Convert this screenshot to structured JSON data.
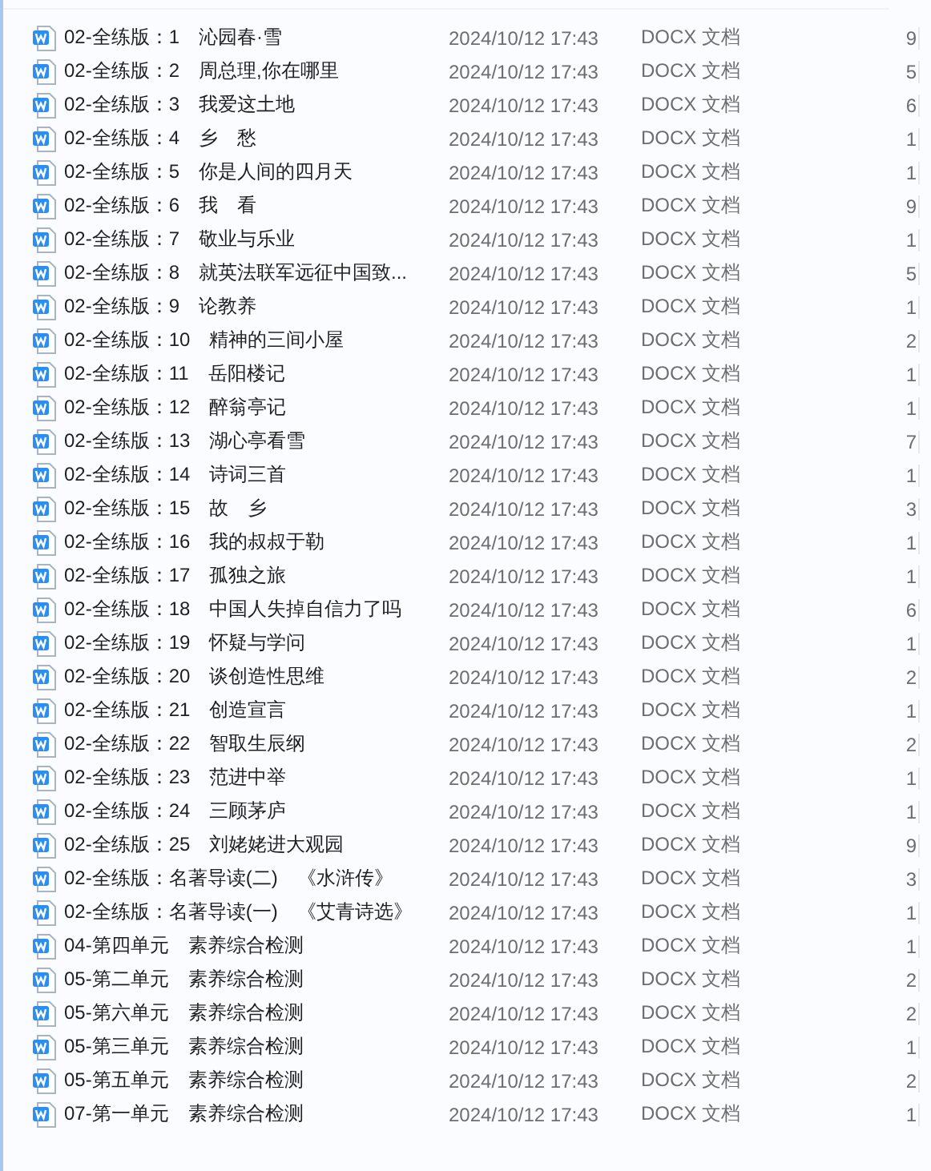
{
  "files": [
    {
      "name": "02-全练版：1　沁园春·雪",
      "modified": "2024/10/12 17:43",
      "type": "DOCX 文档",
      "size": "9"
    },
    {
      "name": "02-全练版：2　周总理,你在哪里",
      "modified": "2024/10/12 17:43",
      "type": "DOCX 文档",
      "size": "5"
    },
    {
      "name": "02-全练版：3　我爱这土地",
      "modified": "2024/10/12 17:43",
      "type": "DOCX 文档",
      "size": "6"
    },
    {
      "name": "02-全练版：4　乡　愁",
      "modified": "2024/10/12 17:43",
      "type": "DOCX 文档",
      "size": "1"
    },
    {
      "name": "02-全练版：5　你是人间的四月天",
      "modified": "2024/10/12 17:43",
      "type": "DOCX 文档",
      "size": "1"
    },
    {
      "name": "02-全练版：6　我　看",
      "modified": "2024/10/12 17:43",
      "type": "DOCX 文档",
      "size": "9"
    },
    {
      "name": "02-全练版：7　敬业与乐业",
      "modified": "2024/10/12 17:43",
      "type": "DOCX 文档",
      "size": "1"
    },
    {
      "name": "02-全练版：8　就英法联军远征中国致...",
      "modified": "2024/10/12 17:43",
      "type": "DOCX 文档",
      "size": "5"
    },
    {
      "name": "02-全练版：9　论教养",
      "modified": "2024/10/12 17:43",
      "type": "DOCX 文档",
      "size": "1"
    },
    {
      "name": "02-全练版：10　精神的三间小屋",
      "modified": "2024/10/12 17:43",
      "type": "DOCX 文档",
      "size": "2"
    },
    {
      "name": "02-全练版：11　岳阳楼记",
      "modified": "2024/10/12 17:43",
      "type": "DOCX 文档",
      "size": "1"
    },
    {
      "name": "02-全练版：12　醉翁亭记",
      "modified": "2024/10/12 17:43",
      "type": "DOCX 文档",
      "size": "1"
    },
    {
      "name": "02-全练版：13　湖心亭看雪",
      "modified": "2024/10/12 17:43",
      "type": "DOCX 文档",
      "size": "7"
    },
    {
      "name": "02-全练版：14　诗词三首",
      "modified": "2024/10/12 17:43",
      "type": "DOCX 文档",
      "size": "1"
    },
    {
      "name": "02-全练版：15　故　乡",
      "modified": "2024/10/12 17:43",
      "type": "DOCX 文档",
      "size": "3"
    },
    {
      "name": "02-全练版：16　我的叔叔于勒",
      "modified": "2024/10/12 17:43",
      "type": "DOCX 文档",
      "size": "1"
    },
    {
      "name": "02-全练版：17　孤独之旅",
      "modified": "2024/10/12 17:43",
      "type": "DOCX 文档",
      "size": "1"
    },
    {
      "name": "02-全练版：18　中国人失掉自信力了吗",
      "modified": "2024/10/12 17:43",
      "type": "DOCX 文档",
      "size": "6"
    },
    {
      "name": "02-全练版：19　怀疑与学问",
      "modified": "2024/10/12 17:43",
      "type": "DOCX 文档",
      "size": "1"
    },
    {
      "name": "02-全练版：20　谈创造性思维",
      "modified": "2024/10/12 17:43",
      "type": "DOCX 文档",
      "size": "2"
    },
    {
      "name": "02-全练版：21　创造宣言",
      "modified": "2024/10/12 17:43",
      "type": "DOCX 文档",
      "size": "1"
    },
    {
      "name": "02-全练版：22　智取生辰纲",
      "modified": "2024/10/12 17:43",
      "type": "DOCX 文档",
      "size": "2"
    },
    {
      "name": "02-全练版：23　范进中举",
      "modified": "2024/10/12 17:43",
      "type": "DOCX 文档",
      "size": "1"
    },
    {
      "name": "02-全练版：24　三顾茅庐",
      "modified": "2024/10/12 17:43",
      "type": "DOCX 文档",
      "size": "1"
    },
    {
      "name": "02-全练版：25　刘姥姥进大观园",
      "modified": "2024/10/12 17:43",
      "type": "DOCX 文档",
      "size": "9"
    },
    {
      "name": "02-全练版：名著导读(二)　《水浒传》",
      "modified": "2024/10/12 17:43",
      "type": "DOCX 文档",
      "size": "3"
    },
    {
      "name": "02-全练版：名著导读(一)　《艾青诗选》",
      "modified": "2024/10/12 17:43",
      "type": "DOCX 文档",
      "size": "1"
    },
    {
      "name": "04-第四单元　素养综合检测",
      "modified": "2024/10/12 17:43",
      "type": "DOCX 文档",
      "size": "1"
    },
    {
      "name": "05-第二单元　素养综合检测",
      "modified": "2024/10/12 17:43",
      "type": "DOCX 文档",
      "size": "2"
    },
    {
      "name": "05-第六单元　素养综合检测",
      "modified": "2024/10/12 17:43",
      "type": "DOCX 文档",
      "size": "2"
    },
    {
      "name": "05-第三单元　素养综合检测",
      "modified": "2024/10/12 17:43",
      "type": "DOCX 文档",
      "size": "1"
    },
    {
      "name": "05-第五单元　素养综合检测",
      "modified": "2024/10/12 17:43",
      "type": "DOCX 文档",
      "size": "2"
    },
    {
      "name": "07-第一单元　素养综合检测",
      "modified": "2024/10/12 17:43",
      "type": "DOCX 文档",
      "size": "1"
    }
  ]
}
